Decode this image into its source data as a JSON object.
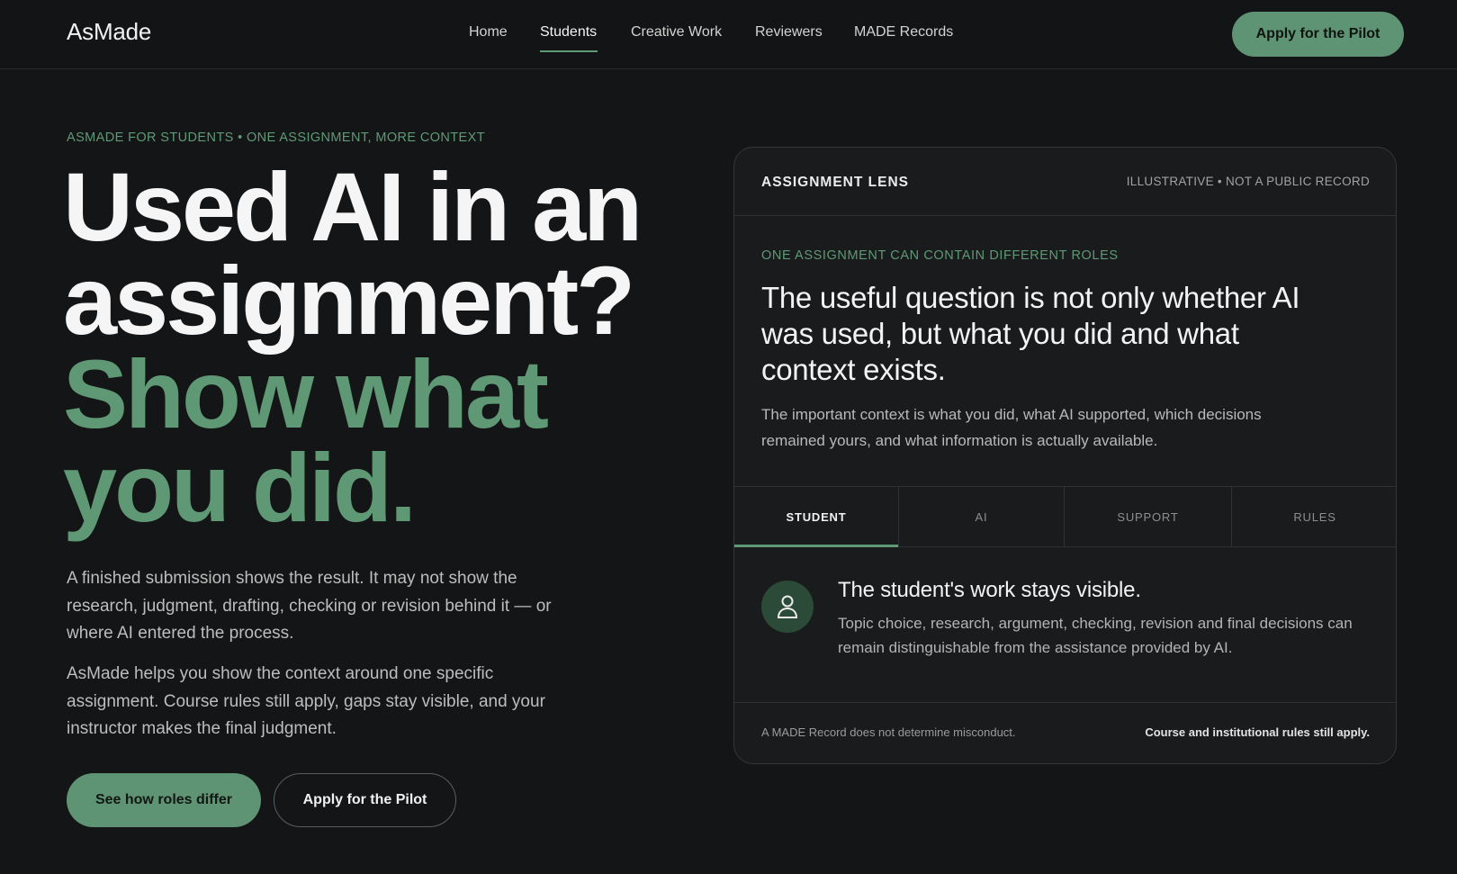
{
  "header": {
    "logo": "AsMade",
    "nav": [
      "Home",
      "Students",
      "Creative Work",
      "Reviewers",
      "MADE Records"
    ],
    "active_nav": "Students",
    "cta_label": "Apply for the Pilot"
  },
  "hero": {
    "eyebrow": "ASMADE FOR STUDENTS • ONE ASSIGNMENT, MORE CONTEXT",
    "headline_line1": "Used AI in an",
    "headline_line2": "assignment?",
    "headline_line3": "Show what",
    "headline_line4": "you did.",
    "paragraph1": "A finished submission shows the result. It may not show the research, judgment, drafting, checking or revision behind it — or where AI entered the process.",
    "paragraph2": "AsMade helps you show the context around one specific assignment. Course rules still apply, gaps stay visible, and your instructor makes the final judgment.",
    "primary_cta": "See how roles differ",
    "secondary_cta": "Apply for the Pilot"
  },
  "card": {
    "title": "ASSIGNMENT LENS",
    "note": "ILLUSTRATIVE • NOT A PUBLIC RECORD",
    "eyebrow": "ONE ASSIGNMENT CAN CONTAIN DIFFERENT ROLES",
    "headline": "The useful question is not only whether AI was used, but what you did and what context exists.",
    "body": "The important context is what you did, what AI supported, which decisions remained yours, and what information is actually available.",
    "tabs": [
      "STUDENT",
      "AI",
      "SUPPORT",
      "RULES"
    ],
    "active_tab": "STUDENT",
    "role_icon": "person-icon",
    "role_title": "The student's work stays visible.",
    "role_description": "Topic choice, research, argument, checking, revision and final decisions can remain distinguishable from the assistance provided by AI.",
    "footer_left": "A MADE Record does not determine misconduct.",
    "footer_right": "Course and institutional rules still apply."
  },
  "colors": {
    "background": "#141516",
    "accent_green": "#5e9a76",
    "button_green": "#5e9474",
    "card_background": "#1a1b1d"
  }
}
